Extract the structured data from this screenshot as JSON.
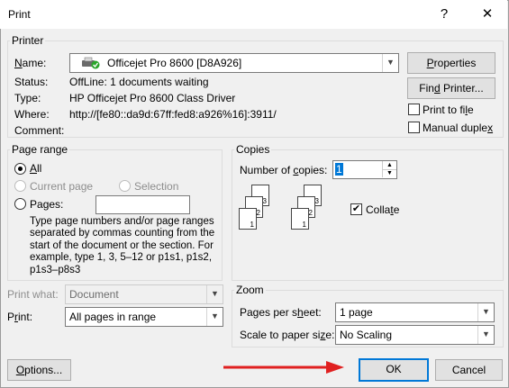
{
  "window": {
    "title": "Print",
    "help": "?",
    "close": "✕"
  },
  "printer": {
    "group_label": "Printer",
    "name_label": "Name:",
    "name_value": "Officejet Pro 8600 [D8A926]",
    "status_label": "Status:",
    "status_value": "OffLine: 1 documents waiting",
    "type_label": "Type:",
    "type_value": "HP Officejet Pro 8600 Class Driver",
    "where_label": "Where:",
    "where_value": "http://[fe80::da9d:67ff:fed8:a926%16]:3911/",
    "comment_label": "Comment:",
    "properties_label": "Properties",
    "find_printer_label": "Find Printer...",
    "print_to_file_label": "Print to file",
    "manual_duplex_label": "Manual duplex"
  },
  "page_range": {
    "group_label": "Page range",
    "all_label": "All",
    "current_page_label": "Current page",
    "selection_label": "Selection",
    "pages_label": "Pages:",
    "pages_value": "",
    "help_text": "Type page numbers and/or page ranges separated by commas counting from the start of the document or the section. For example, type 1, 3, 5–12 or p1s1, p1s2, p1s3–p8s3"
  },
  "copies": {
    "group_label": "Copies",
    "number_label": "Number of copies:",
    "number_value": "1",
    "collate_label": "Collate",
    "collate_checked": true
  },
  "print_what": {
    "label": "Print what:",
    "value": "Document"
  },
  "print": {
    "label": "Print:",
    "value": "All pages in range"
  },
  "zoom": {
    "group_label": "Zoom",
    "pages_per_sheet_label": "Pages per sheet:",
    "pages_per_sheet_value": "1 page",
    "scale_label": "Scale to paper size:",
    "scale_value": "No Scaling"
  },
  "buttons": {
    "options": "Options...",
    "ok": "OK",
    "cancel": "Cancel"
  },
  "colors": {
    "accent": "#0078d7",
    "arrow": "#e02020",
    "status_icon": "#2aa52a"
  },
  "icons": {
    "printer": "printer-status-icon",
    "arrow": "red-arrow-annotation"
  }
}
